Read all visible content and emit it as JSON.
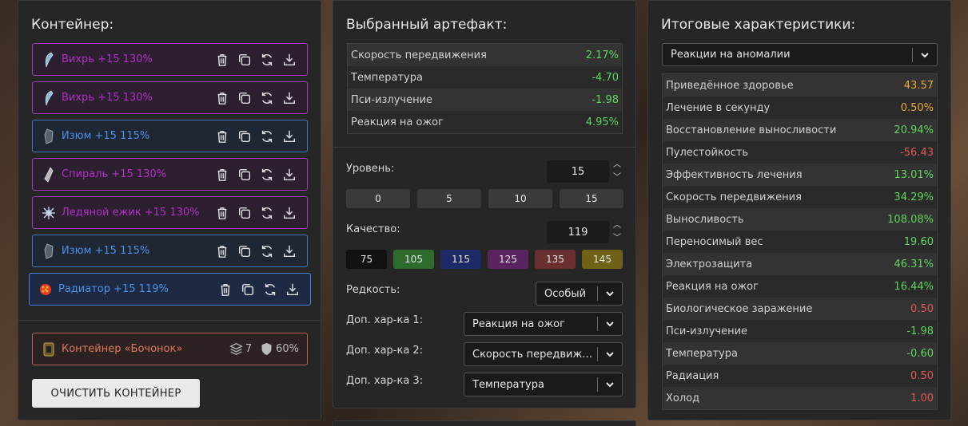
{
  "container_panel": {
    "title": "Контейнер:",
    "items": [
      {
        "label": "Вихрь +15 130%",
        "icon": "vortex-artifact-icon",
        "color": "purple"
      },
      {
        "label": "Вихрь +15 130%",
        "icon": "vortex-artifact-icon",
        "color": "purple"
      },
      {
        "label": "Изюм +15 115%",
        "icon": "izum-artifact-icon",
        "color": "blue"
      },
      {
        "label": "Спираль +15 130%",
        "icon": "spiral-artifact-icon",
        "color": "purple"
      },
      {
        "label": "Ледяной ежик +15 130%",
        "icon": "ice-hedgehog-artifact-icon",
        "color": "purple"
      },
      {
        "label": "Изюм +15 115%",
        "icon": "izum-artifact-icon",
        "color": "blue"
      },
      {
        "label": "Радиатор +15 119%",
        "icon": "radiator-artifact-icon",
        "color": "blue"
      }
    ],
    "container": {
      "name": "Контейнер «Бочонок»",
      "slots": "7",
      "protection": "60%"
    },
    "clear_button": "ОЧИСТИТЬ КОНТЕЙНЕР"
  },
  "artifact_panel": {
    "title": "Выбранный артефакт:",
    "stats": [
      {
        "name": "Скорость передвижения",
        "value": "2.17%",
        "tone": "green"
      },
      {
        "name": "Температура",
        "value": "-4.70",
        "tone": "green"
      },
      {
        "name": "Пси-излучение",
        "value": "-1.98",
        "tone": "green"
      },
      {
        "name": "Реакция на ожог",
        "value": "4.95%",
        "tone": "green"
      }
    ],
    "level_label": "Уровень:",
    "level_value": "15",
    "level_buttons": [
      "0",
      "5",
      "10",
      "15"
    ],
    "quality_label": "Качество:",
    "quality_value": "119",
    "quality_buttons": [
      {
        "label": "75",
        "color": "#121212"
      },
      {
        "label": "105",
        "color": "#2f6b2f"
      },
      {
        "label": "115",
        "color": "#1d2a66"
      },
      {
        "label": "125",
        "color": "#5a2460"
      },
      {
        "label": "135",
        "color": "#6a2f2f"
      },
      {
        "label": "145",
        "color": "#6e6118"
      }
    ],
    "rarity_label": "Редкость:",
    "rarity_value": "Особый",
    "extra1_label": "Доп. хар-ка 1:",
    "extra1_value": "Реакция на ожог",
    "extra2_label": "Доп. хар-ка 2:",
    "extra2_value": "Скорость передвижения",
    "extra3_label": "Доп. хар-ка 3:",
    "extra3_value": "Температура"
  },
  "summary_panel": {
    "title": "Итоговые характеристики:",
    "filter_value": "Реакции на аномалии",
    "stats": [
      {
        "name": "Приведённое здоровье",
        "value": "43.57",
        "tone": "orange"
      },
      {
        "name": "Лечение в секунду",
        "value": "0.50%",
        "tone": "orange"
      },
      {
        "name": "Восстановление выносливости",
        "value": "20.94%",
        "tone": "green"
      },
      {
        "name": "Пулестойкость",
        "value": "-56.43",
        "tone": "red"
      },
      {
        "name": "Эффективность лечения",
        "value": "13.01%",
        "tone": "green"
      },
      {
        "name": "Скорость передвижения",
        "value": "34.29%",
        "tone": "green"
      },
      {
        "name": "Выносливость",
        "value": "108.08%",
        "tone": "green"
      },
      {
        "name": "Переносимый вес",
        "value": "19.60",
        "tone": "green"
      },
      {
        "name": "Электрозащита",
        "value": "46.31%",
        "tone": "green"
      },
      {
        "name": "Реакция на ожог",
        "value": "16.44%",
        "tone": "green"
      },
      {
        "name": "Биологическое заражение",
        "value": "0.50",
        "tone": "red"
      },
      {
        "name": "Пси-излучение",
        "value": "-1.98",
        "tone": "green"
      },
      {
        "name": "Температура",
        "value": "-0.60",
        "tone": "green"
      },
      {
        "name": "Радиация",
        "value": "0.50",
        "tone": "red"
      },
      {
        "name": "Холод",
        "value": "1.00",
        "tone": "red"
      }
    ]
  }
}
